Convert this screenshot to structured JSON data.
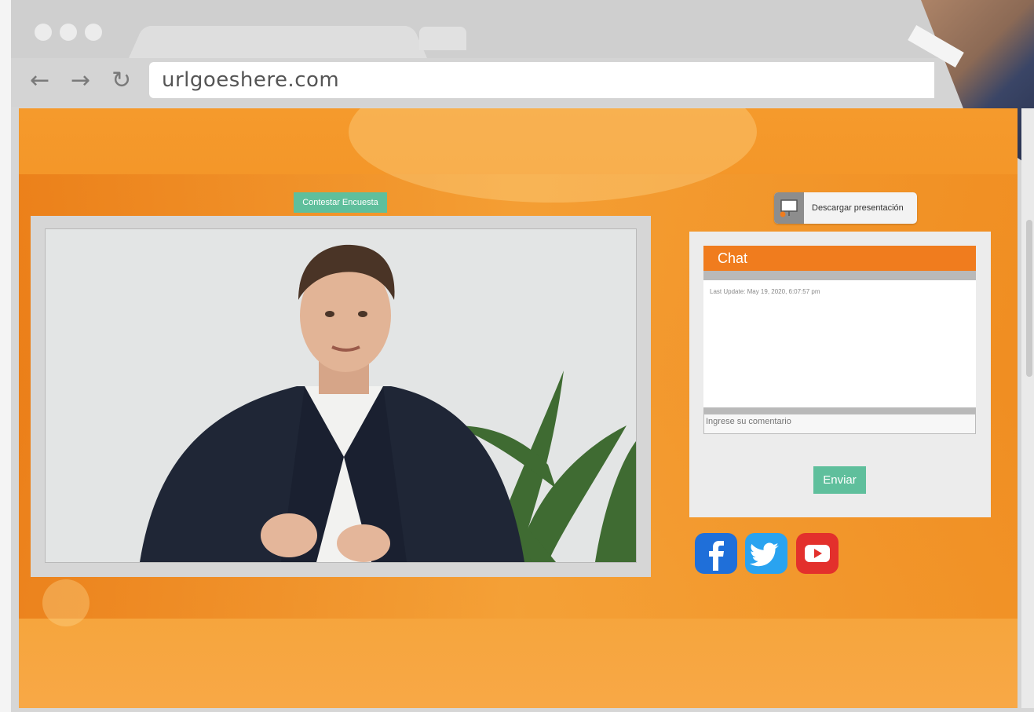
{
  "browser": {
    "url": "urlgoeshere.com",
    "back_icon": "back-arrow-icon",
    "forward_icon": "forward-arrow-icon",
    "reload_icon": "reload-icon"
  },
  "page": {
    "survey_button": "Contestar Encuesta",
    "download_button": "Descargar presentación",
    "chat": {
      "title": "Chat",
      "last_update": "Last Update: May 19, 2020, 6:07:57 pm",
      "input_placeholder": "Ingrese su comentario",
      "send_label": "Enviar"
    },
    "social": [
      "facebook-icon",
      "twitter-icon",
      "youtube-icon"
    ]
  },
  "colors": {
    "orange_bg": "#f28c1f",
    "chat_header": "#f07c1e",
    "button_green": "#5fbf9c",
    "facebook": "#1f6fd9",
    "twitter": "#2aa3f0",
    "youtube": "#e3302c"
  }
}
